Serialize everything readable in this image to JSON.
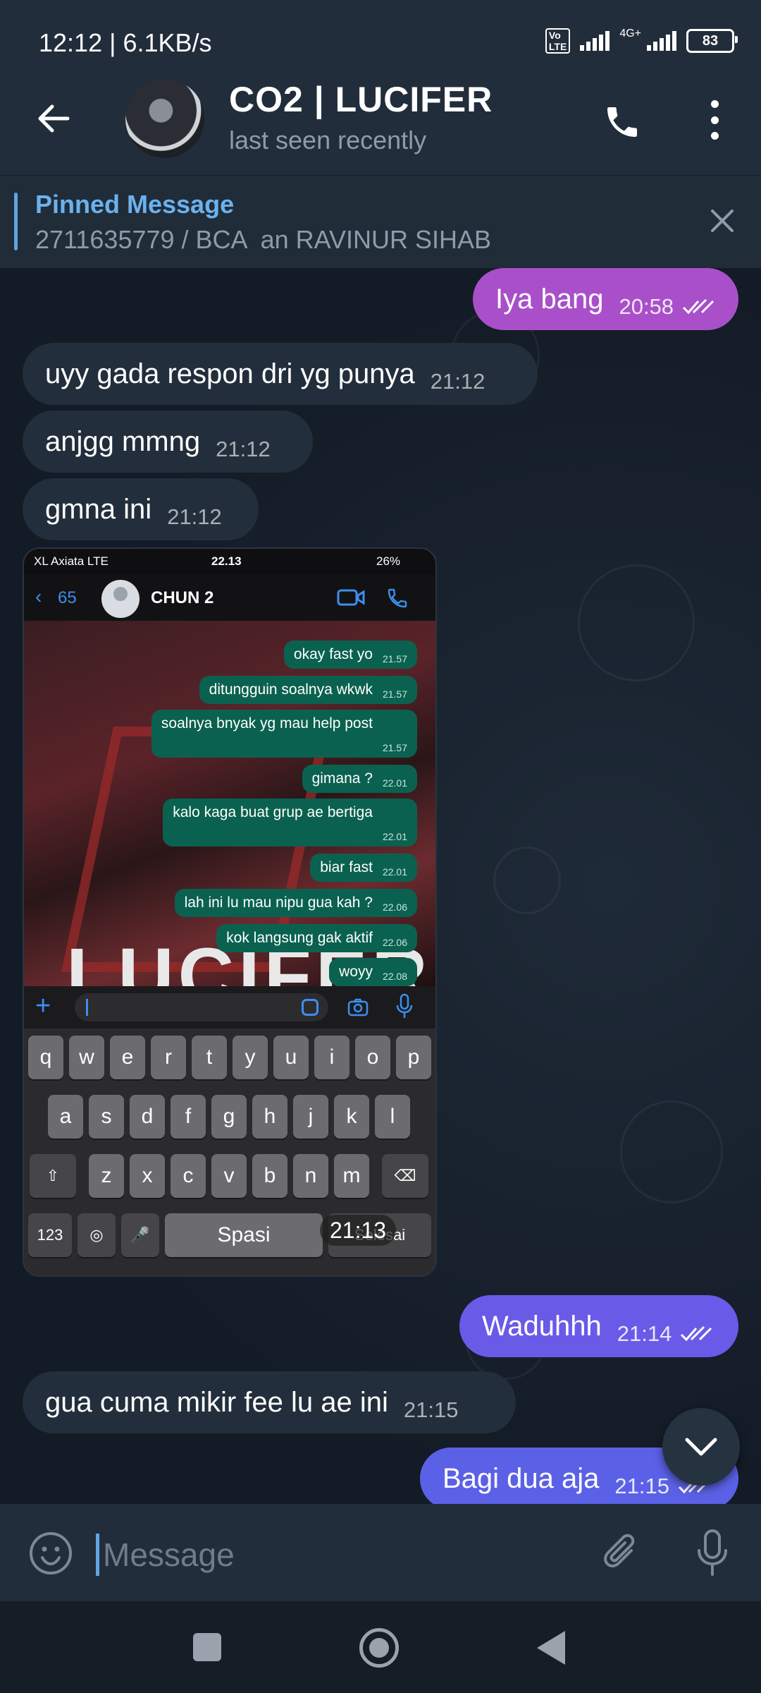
{
  "status_bar": {
    "time_speed": "12:12 | 6.1KB/s",
    "volte": "Vo LTE",
    "network": "4G+",
    "battery": "83"
  },
  "header": {
    "title": "CO2 | LUCIFER",
    "subtitle": "last seen recently"
  },
  "pinned": {
    "title": "Pinned Message",
    "text": "2711635779 / BCA  an RAVINUR SIHAB"
  },
  "messages": [
    {
      "dir": "out",
      "text": "Iya bang",
      "time": "20:58"
    },
    {
      "dir": "in",
      "text": "uyy gada respon dri yg punya",
      "time": "21:12"
    },
    {
      "dir": "in",
      "text": "anjgg mmng",
      "time": "21:12"
    },
    {
      "dir": "in",
      "text": "gmna ini",
      "time": "21:12"
    },
    {
      "dir": "in",
      "type": "photo",
      "time": "21:13"
    },
    {
      "dir": "out",
      "text": "Waduhhh",
      "time": "21:14"
    },
    {
      "dir": "in",
      "text": "gua cuma mikir fee lu ae ini",
      "time": "21:15"
    },
    {
      "dir": "out",
      "text": "Bagi dua aja",
      "time": "21:15"
    }
  ],
  "photo": {
    "status": {
      "carrier": "XL Axiata  LTE",
      "time": "22.13",
      "battery": "26%"
    },
    "header": {
      "back_count": "65",
      "name": "CHUN 2"
    },
    "wa_messages": [
      {
        "text": "okay fast yo",
        "time": "21.57"
      },
      {
        "text": "ditungguin soalnya wkwk",
        "time": "21.57"
      },
      {
        "text": "soalnya bnyak yg mau help post",
        "time": "21.57"
      },
      {
        "text": "gimana ?",
        "time": "22.01"
      },
      {
        "text": "kalo kaga buat grup ae bertiga",
        "time": "22.01"
      },
      {
        "text": "biar fast",
        "time": "22.01"
      },
      {
        "text": "lah ini lu mau nipu gua kah ?",
        "time": "22.06"
      },
      {
        "text": "kok langsung gak aktif",
        "time": "22.06"
      },
      {
        "text": "woyy",
        "time": "22.08"
      }
    ],
    "wallpaper_text": "LUCIFER",
    "keyboard": {
      "row1": [
        "q",
        "w",
        "e",
        "r",
        "t",
        "y",
        "u",
        "i",
        "o",
        "p"
      ],
      "row2": [
        "a",
        "s",
        "d",
        "f",
        "g",
        "h",
        "j",
        "k",
        "l"
      ],
      "row3": [
        "z",
        "x",
        "c",
        "v",
        "b",
        "n",
        "m"
      ],
      "numbers": "123",
      "space": "Spasi",
      "return": "Selesai"
    }
  },
  "composer": {
    "placeholder": "Message"
  },
  "colors": {
    "accent": "#5ea6e1",
    "out_bubble_1": "#a94fc9",
    "out_bubble_2": "#6a5ae8",
    "in_bubble": "#222e3b",
    "whatsapp_bubble": "#0b6150"
  }
}
